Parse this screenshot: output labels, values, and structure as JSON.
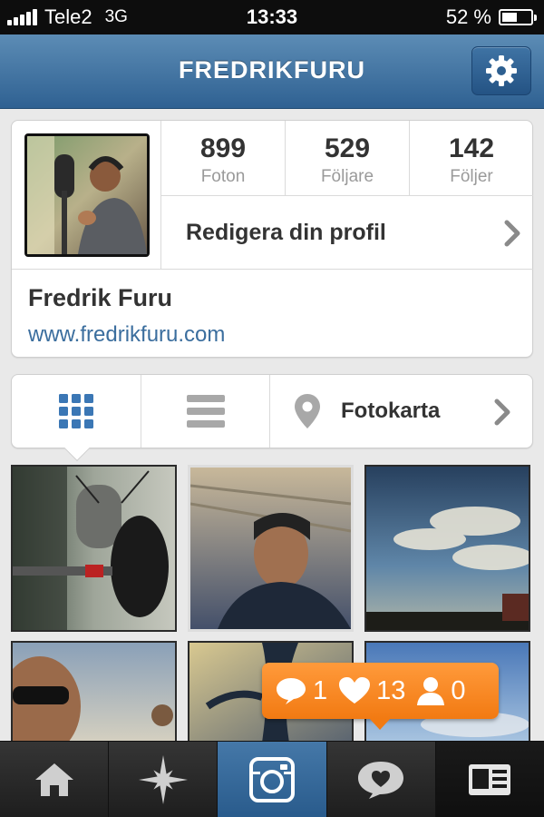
{
  "status_bar": {
    "carrier": "Tele2",
    "network": "3G",
    "time": "13:33",
    "battery": "52 %",
    "battery_level": 0.52
  },
  "nav": {
    "title": "FREDRIKFURU",
    "settings_icon": "gear-icon"
  },
  "profile": {
    "stats": [
      {
        "value": "899",
        "label": "Foton"
      },
      {
        "value": "529",
        "label": "Följare"
      },
      {
        "value": "142",
        "label": "Följer"
      }
    ],
    "edit_label": "Redigera din profil",
    "full_name": "Fredrik Furu",
    "website": "www.fredrikfuru.com"
  },
  "view_switch": {
    "grid_icon": "grid-icon",
    "list_icon": "list-icon",
    "map_icon": "map-pin-icon",
    "map_label": "Fotokarta"
  },
  "notification": {
    "comments": "1",
    "likes": "13",
    "follows": "0"
  },
  "tabs": [
    {
      "icon": "home-icon"
    },
    {
      "icon": "explore-star-icon"
    },
    {
      "icon": "camera-icon"
    },
    {
      "icon": "news-heart-bubble-icon"
    },
    {
      "icon": "profile-card-icon"
    }
  ],
  "colors": {
    "nav_blue": "#2f6192",
    "link_blue": "#3b6e9e",
    "notification_orange": "#f27a12"
  }
}
